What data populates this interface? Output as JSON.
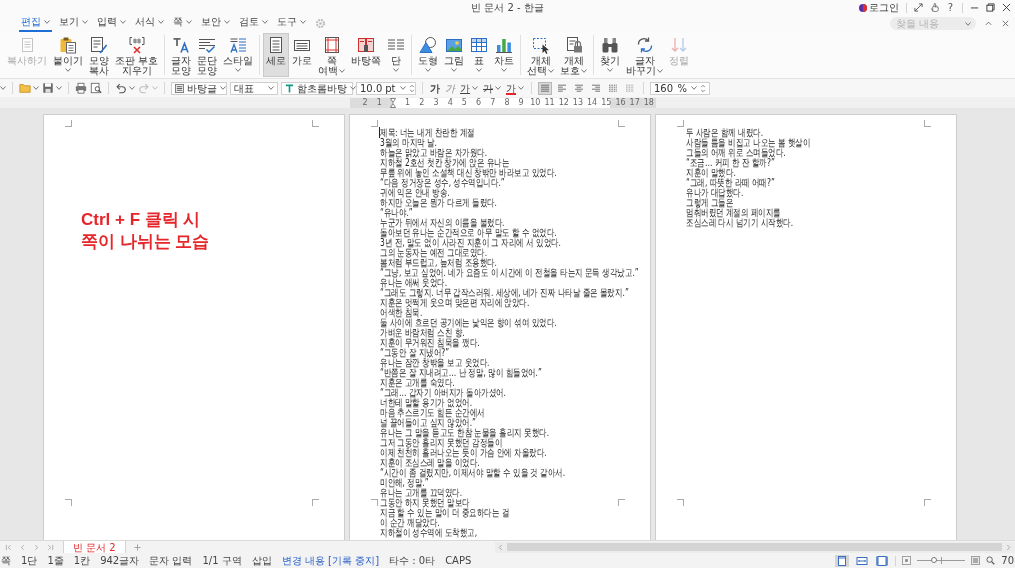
{
  "window": {
    "title": "빈 문서 2 - 한글",
    "account": "로그인",
    "help": "?"
  },
  "menu_tabs": [
    {
      "label": "편집",
      "selected": true
    },
    {
      "label": "보기",
      "selected": false
    },
    {
      "label": "입력",
      "selected": false
    },
    {
      "label": "서식",
      "selected": false
    },
    {
      "label": "쪽",
      "selected": false
    },
    {
      "label": "보안",
      "selected": false
    },
    {
      "label": "검토",
      "selected": false
    },
    {
      "label": "도구",
      "selected": false
    }
  ],
  "find_field": {
    "placeholder": "찾을 내용"
  },
  "ribbon": {
    "groups": [
      [
        {
          "kind": "copy",
          "label": "복사하기",
          "disabled": true,
          "selected": false,
          "dropdown": false
        },
        {
          "kind": "paste",
          "label": "붙이기",
          "disabled": false,
          "selected": false,
          "dropdown": true
        },
        {
          "kind": "painter",
          "label": "모양\n복사",
          "disabled": false,
          "selected": false,
          "dropdown": false
        },
        {
          "kind": "eraser",
          "label": "조판 부호\n지우기",
          "disabled": false,
          "selected": false,
          "dropdown": false
        }
      ],
      [
        {
          "kind": "charshape",
          "label": "글자\n모양",
          "disabled": false,
          "selected": false,
          "dropdown": false
        },
        {
          "kind": "parashape",
          "label": "문단\n모양",
          "disabled": false,
          "selected": false,
          "dropdown": false
        },
        {
          "kind": "style",
          "label": "스타일",
          "disabled": false,
          "selected": false,
          "dropdown": true
        }
      ],
      [
        {
          "kind": "portrait",
          "label": "세로",
          "disabled": false,
          "selected": true,
          "dropdown": false
        },
        {
          "kind": "landscape",
          "label": "가로",
          "disabled": false,
          "selected": false,
          "dropdown": false
        },
        {
          "kind": "margins",
          "label": "쪽\n여백",
          "disabled": false,
          "selected": false,
          "dropdown": true
        },
        {
          "kind": "masterpage",
          "label": "바탕쪽",
          "disabled": false,
          "selected": false,
          "dropdown": false
        },
        {
          "kind": "columns",
          "label": "단",
          "disabled": false,
          "selected": false,
          "dropdown": true
        }
      ],
      [
        {
          "kind": "shape",
          "label": "도형",
          "disabled": false,
          "selected": false,
          "dropdown": true
        },
        {
          "kind": "picture",
          "label": "그림",
          "disabled": false,
          "selected": false,
          "dropdown": true
        },
        {
          "kind": "table",
          "label": "표",
          "disabled": false,
          "selected": false,
          "dropdown": true
        },
        {
          "kind": "chart",
          "label": "차트",
          "disabled": false,
          "selected": false,
          "dropdown": true
        }
      ],
      [
        {
          "kind": "select",
          "label": "개체\n선택",
          "disabled": false,
          "selected": false,
          "dropdown": true
        },
        {
          "kind": "protect",
          "label": "개체\n보호",
          "disabled": false,
          "selected": false,
          "dropdown": true
        }
      ],
      [
        {
          "kind": "find",
          "label": "찾기",
          "disabled": false,
          "selected": false,
          "dropdown": true
        },
        {
          "kind": "replace",
          "label": "글자\n바꾸기",
          "disabled": false,
          "selected": false,
          "dropdown": true
        },
        {
          "kind": "sort",
          "label": "정렬",
          "disabled": true,
          "selected": false,
          "dropdown": false
        }
      ]
    ]
  },
  "toolbar": {
    "file_buttons": [
      {
        "kind": "menu",
        "dropdown": true,
        "disabled": false
      },
      {
        "kind": "open",
        "dropdown": true,
        "disabled": false
      },
      {
        "kind": "save",
        "dropdown": true,
        "disabled": false
      },
      {
        "kind": "print",
        "dropdown": false,
        "disabled": false
      },
      {
        "kind": "preview",
        "dropdown": false,
        "disabled": false
      },
      {
        "kind": "undo",
        "dropdown": true,
        "disabled": false
      },
      {
        "kind": "redo",
        "dropdown": true,
        "disabled": true
      }
    ],
    "style_box": {
      "value": "바탕글"
    },
    "type_box": {
      "value": "대표"
    },
    "font_box": {
      "value": "함초롬바탕"
    },
    "size_box": {
      "value": "10.0",
      "unit": "pt"
    },
    "char_buttons": [
      {
        "kind": "bold",
        "label": "가",
        "dropdown": false
      },
      {
        "kind": "italic",
        "label": "가",
        "dropdown": false
      },
      {
        "kind": "underline",
        "label": "가",
        "dropdown": true
      },
      {
        "kind": "strike",
        "label": "가",
        "dropdown": true
      },
      {
        "kind": "color",
        "label": "가",
        "dropdown": true,
        "color": "#e3262b"
      }
    ],
    "align_buttons": [
      {
        "kind": "justify",
        "selected": true
      },
      {
        "kind": "left",
        "selected": false
      },
      {
        "kind": "center",
        "selected": false
      },
      {
        "kind": "right",
        "selected": false
      },
      {
        "kind": "distribute",
        "selected": false
      },
      {
        "kind": "divide",
        "selected": false
      }
    ],
    "zoom_box": {
      "value": "160",
      "unit": "%"
    }
  },
  "ruler": {
    "left_labels": [
      "2",
      "1"
    ],
    "right_labels": [
      "1",
      "2",
      "3",
      "4",
      "5",
      "6",
      "7",
      "8",
      "9",
      "10",
      "11",
      "12",
      "13",
      "14",
      "15",
      "16",
      "17",
      "18"
    ]
  },
  "document": {
    "pages": [
      {
        "kind": "note",
        "text": "Ctrl + F 클릭 시\n쪽이 나뉘는 모습"
      },
      {
        "kind": "body",
        "lines": [
          "제목: 너는 내게 찬란한 계절",
          "3월의 마지막 날.",
          "하늘은 맑았고 바람은 차가웠다.",
          "지하철 2호선 첫칸 창가에 앉은 유나는",
          "무릎 위에 놓인 소설책 대신 창밖만 바라보고 있었다.",
          "“다음 정거장은 성수, 성수역입니다.”",
          "귀에 익은 안내 방송.",
          "하지만 오늘은 뭔가 다르게 들렸다.",
          "“유나야.”",
          "누군가 뒤에서 자신의 이름을 불렀다.",
          "돌아보던 유나는 순간적으로 아무 말도 할 수 없었다.",
          "3년 전, 말도 없이 사라진 지훈이 그 자리에 서 있었다.",
          "그의 눈동자는 예전 그대로였다.",
          "봄처럼 부드럽고, 늪처럼 조용했다.",
          "“그냥, 보고 싶었어. 네가 요즘도 이 시간에 이 전철을 타는지 문득 생각났고.”",
          "유나는 애써 웃었다.",
          "“그래도 그렇지. 너무 갑작스러워. 세상에, 네가 진짜 나타날 줄은 몰랐지.”",
          "지훈은 멋쩍게 웃으며 맞은편 자리에 앉았다.",
          "어색한 침묵.",
          "둘 사이에 흐르던 공기에는 낯익은 향이 섞여 있었다.",
          "가벼운 바람처럼 스친 향.",
          "지훈이 무거워진 침묵을 깼다.",
          "“그동안 잘 지냈어?”",
          "유나는 잠깐 창밖을 보고 웃었다.",
          "“반쯤은 잘 지내려고… 난 정말, 많이 힘들었어.”",
          "지훈은 고개를 숙였다.",
          "“그래… 갑자기 아버지가 돌아가셨어.",
          "너한테 말할 용기가 없었어.",
          "마음 추스르기도 힘든 순간에서",
          "널 끌어들이고 싶지 않았어.”",
          "유나는 그 말을 듣고도 한참 눈물을 흘리지 못했다.",
          "그저 그동안 흘리지 못했던 감정들이",
          "이제 천천히 흘러나오는 듯이 가슴 안에 차올랐다.",
          "지훈이 조심스레 말을 이었다.",
          "“시간이 좀 걸렸지만, 이제서야 말할 수 있을 것 같아서.",
          "미안해, 정말.”",
          "유나는 고개를 끄덕였다.",
          "그동안 하지 못했던 말보다",
          "지금 할 수 있는 말이 더 중요하다는 걸",
          "이 순간 깨달았다.",
          "지하철이 성수역에 도착했고,"
        ]
      },
      {
        "kind": "body",
        "lines": [
          "두 사람은 함께 내렸다.",
          "사람들 틈을 비집고 나오는 봄 햇살이",
          "그들의 어깨 위로 스며들었다.",
          "“조금… 커피 한 잔 할까?”",
          "지훈이 말했다.",
          "“그래, 따뜻한 라떼 어때?”",
          "유나가 대답했다.",
          "그렇게 그들은",
          "멈춰버렸던 계절의 페이지를",
          "조심스레 다시 넘기기 시작했다."
        ]
      }
    ]
  },
  "document_tabs": [
    {
      "label": "빈 문서 2",
      "selected": true
    }
  ],
  "status_bar": {
    "items": [
      {
        "kind": "text",
        "text": "쪽"
      },
      {
        "kind": "text",
        "text": "1단"
      },
      {
        "kind": "text",
        "text": "1줄"
      },
      {
        "kind": "text",
        "text": "1칸"
      },
      {
        "kind": "text",
        "text": "942글자"
      },
      {
        "kind": "text",
        "text": "문자 입력"
      },
      {
        "kind": "text",
        "text": "1/1 구역"
      },
      {
        "kind": "text",
        "text": "삽입"
      },
      {
        "kind": "link",
        "text": "변경 내용 [기록 중지]"
      },
      {
        "kind": "text",
        "text": "타수 : 0타"
      },
      {
        "kind": "text",
        "text": "CAPS"
      }
    ],
    "view_buttons": [
      {
        "kind": "page",
        "selected": true
      },
      {
        "kind": "width",
        "selected": false
      },
      {
        "kind": "full",
        "selected": false
      }
    ],
    "zoom_slider": {
      "level": 0.35
    },
    "zoom_label": "70"
  }
}
